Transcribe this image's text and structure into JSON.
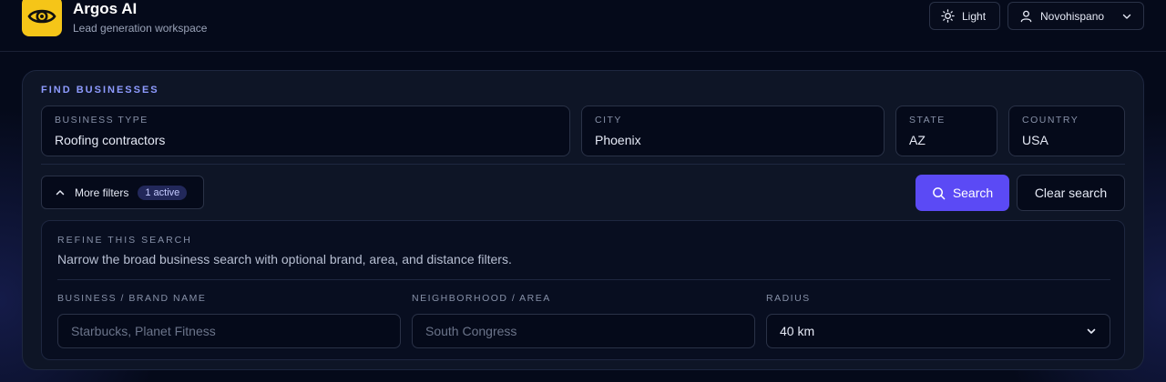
{
  "header": {
    "app_title": "Argos AI",
    "app_subtitle": "Lead generation workspace",
    "theme_label": "Light",
    "user_name": "Novohispano",
    "logo_icon": "eye-icon",
    "logo_color": "#f5c518"
  },
  "search": {
    "heading": "FIND BUSINESSES",
    "fields": {
      "business_type": {
        "label": "BUSINESS TYPE",
        "value": "Roofing contractors"
      },
      "city": {
        "label": "CITY",
        "value": "Phoenix"
      },
      "state": {
        "label": "STATE",
        "value": "AZ"
      },
      "country": {
        "label": "COUNTRY",
        "value": "USA"
      }
    },
    "more_filters_label": "More filters",
    "active_badge": "1 active",
    "search_label": "Search",
    "clear_label": "Clear search",
    "accent_color": "#5b4af5"
  },
  "refine": {
    "title": "REFINE THIS SEARCH",
    "description": "Narrow the broad business search with optional brand, area, and distance filters.",
    "brand": {
      "label": "BUSINESS / BRAND NAME",
      "placeholder": "Starbucks, Planet Fitness"
    },
    "area": {
      "label": "NEIGHBORHOOD / AREA",
      "placeholder": "South Congress"
    },
    "radius": {
      "label": "RADIUS",
      "value": "40 km"
    }
  }
}
